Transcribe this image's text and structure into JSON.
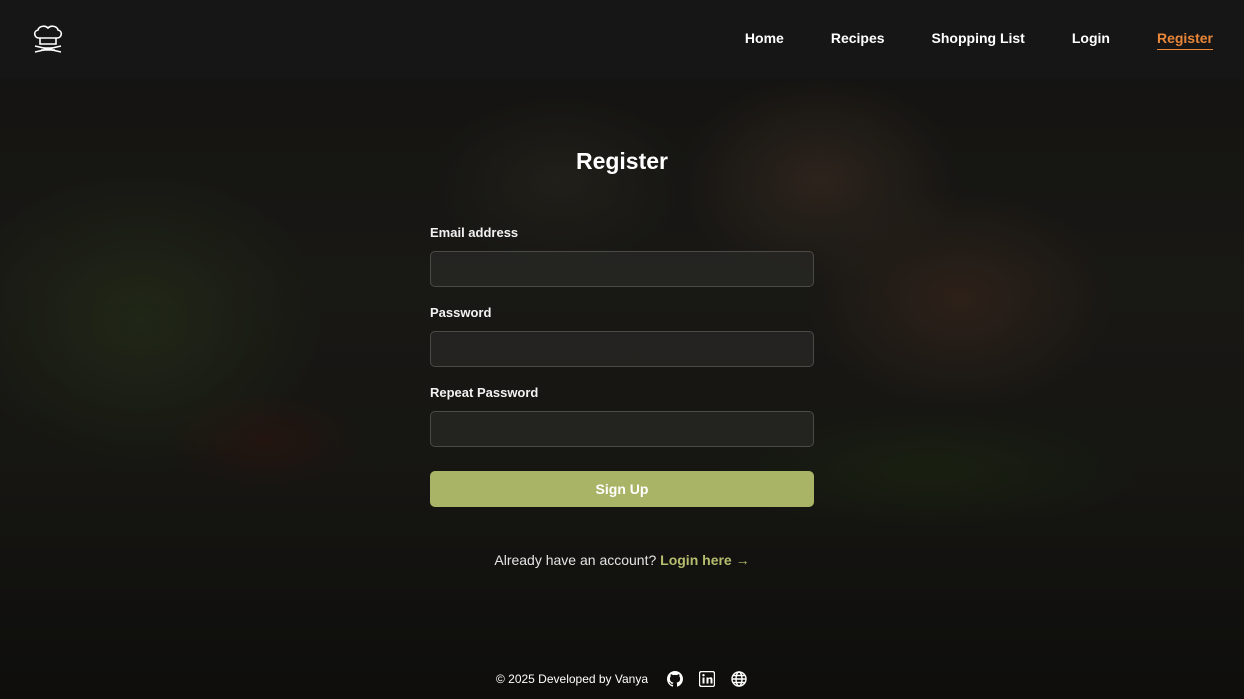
{
  "nav": {
    "logo_icon": "chef-hat-icon",
    "items": [
      {
        "label": "Home"
      },
      {
        "label": "Recipes"
      },
      {
        "label": "Shopping List"
      },
      {
        "label": "Login"
      },
      {
        "label": "Register",
        "active": true
      }
    ]
  },
  "form": {
    "title": "Register",
    "fields": [
      {
        "label": "Email address",
        "value": "",
        "placeholder": ""
      },
      {
        "label": "Password",
        "value": "",
        "placeholder": ""
      },
      {
        "label": "Repeat Password",
        "value": "",
        "placeholder": ""
      }
    ],
    "submit_label": "Sign Up",
    "switch_text": "Already have an account?",
    "switch_link": "Login here →"
  },
  "footer": {
    "text": "© 2025 Developed by Vanya",
    "icons": [
      "github-icon",
      "linkedin-icon",
      "globe-icon"
    ]
  },
  "colors": {
    "accent": "#e8873a",
    "button": "#a9b466",
    "link": "#b5bd6e",
    "header_bg": "#161616"
  }
}
